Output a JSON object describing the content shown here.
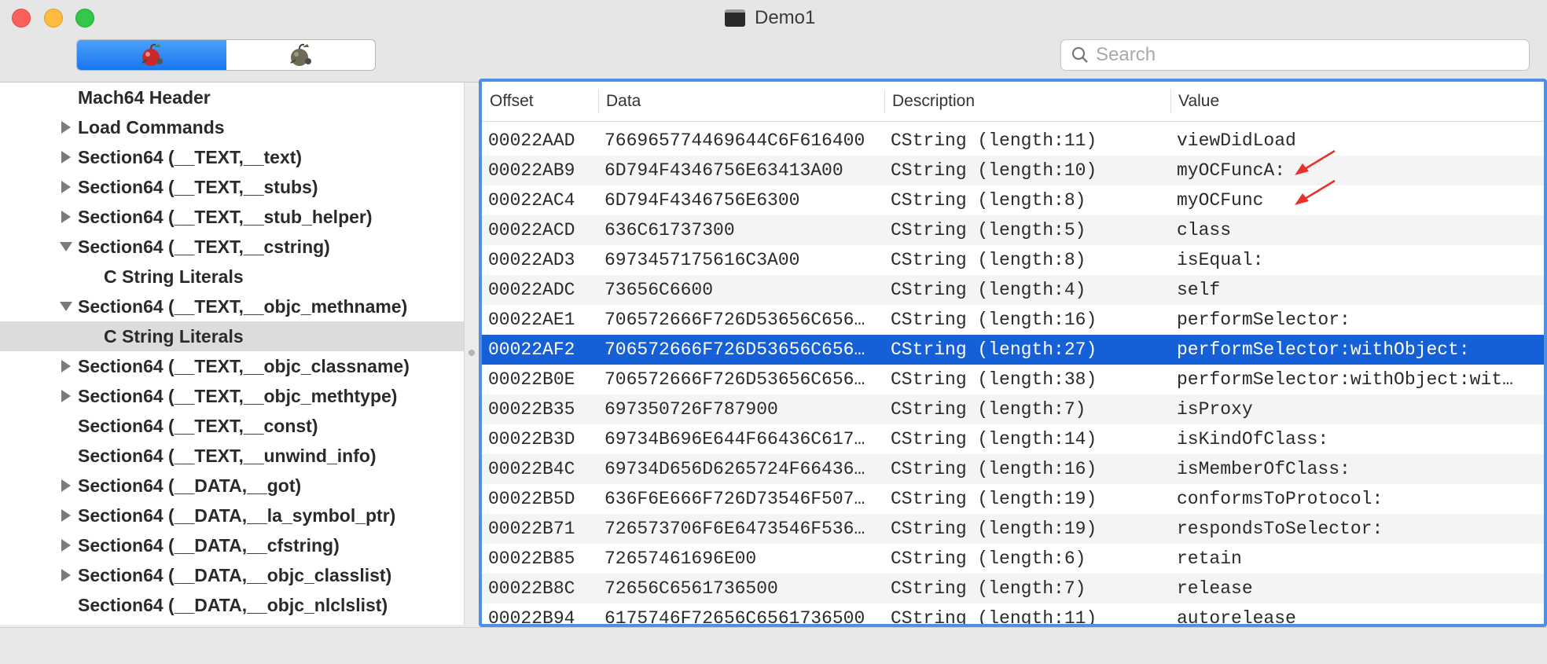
{
  "window": {
    "title": "Demo1"
  },
  "toolbar": {
    "segments": [
      {
        "icon": "apple-bomb-red-icon"
      },
      {
        "icon": "apple-bomb-gray-icon"
      }
    ],
    "search": {
      "placeholder": "Search",
      "value": ""
    }
  },
  "tree": [
    {
      "label": "Mach64 Header",
      "level": 0,
      "disclosure": "none"
    },
    {
      "label": "Load Commands",
      "level": 0,
      "disclosure": "collapsed"
    },
    {
      "label": "Section64 (__TEXT,__text)",
      "level": 0,
      "disclosure": "collapsed"
    },
    {
      "label": "Section64 (__TEXT,__stubs)",
      "level": 0,
      "disclosure": "collapsed"
    },
    {
      "label": "Section64 (__TEXT,__stub_helper)",
      "level": 0,
      "disclosure": "collapsed"
    },
    {
      "label": "Section64 (__TEXT,__cstring)",
      "level": 0,
      "disclosure": "expanded"
    },
    {
      "label": "C String Literals",
      "level": 1,
      "disclosure": "none"
    },
    {
      "label": "Section64 (__TEXT,__objc_methname)",
      "level": 0,
      "disclosure": "expanded"
    },
    {
      "label": "C String Literals",
      "level": 1,
      "disclosure": "none",
      "selected": true
    },
    {
      "label": "Section64 (__TEXT,__objc_classname)",
      "level": 0,
      "disclosure": "collapsed"
    },
    {
      "label": "Section64 (__TEXT,__objc_methtype)",
      "level": 0,
      "disclosure": "collapsed"
    },
    {
      "label": "Section64 (__TEXT,__const)",
      "level": 0,
      "disclosure": "none"
    },
    {
      "label": "Section64 (__TEXT,__unwind_info)",
      "level": 0,
      "disclosure": "none"
    },
    {
      "label": "Section64 (__DATA,__got)",
      "level": 0,
      "disclosure": "collapsed"
    },
    {
      "label": "Section64 (__DATA,__la_symbol_ptr)",
      "level": 0,
      "disclosure": "collapsed"
    },
    {
      "label": "Section64 (__DATA,__cfstring)",
      "level": 0,
      "disclosure": "collapsed"
    },
    {
      "label": "Section64 (__DATA,__objc_classlist)",
      "level": 0,
      "disclosure": "collapsed"
    },
    {
      "label": "Section64 (__DATA,__objc_nlclslist)",
      "level": 0,
      "disclosure": "none"
    }
  ],
  "table": {
    "columns": [
      "Offset",
      "Data",
      "Description",
      "Value"
    ],
    "rows": [
      {
        "offset": "00022AAD",
        "data": "766965774469644C6F616400",
        "description": "CString (length:11)",
        "value": "viewDidLoad"
      },
      {
        "offset": "00022AB9",
        "data": "6D794F4346756E63413A00",
        "description": "CString (length:10)",
        "value": "myOCFuncA:",
        "annotated": true
      },
      {
        "offset": "00022AC4",
        "data": "6D794F4346756E6300",
        "description": "CString (length:8)",
        "value": "myOCFunc",
        "annotated": true
      },
      {
        "offset": "00022ACD",
        "data": "636C61737300",
        "description": "CString (length:5)",
        "value": "class"
      },
      {
        "offset": "00022AD3",
        "data": "6973457175616C3A00",
        "description": "CString (length:8)",
        "value": "isEqual:"
      },
      {
        "offset": "00022ADC",
        "data": "73656C6600",
        "description": "CString (length:4)",
        "value": "self"
      },
      {
        "offset": "00022AE1",
        "data": "706572666F726D53656C656…",
        "description": "CString (length:16)",
        "value": "performSelector:"
      },
      {
        "offset": "00022AF2",
        "data": "706572666F726D53656C656…",
        "description": "CString (length:27)",
        "value": "performSelector:withObject:",
        "selected": true
      },
      {
        "offset": "00022B0E",
        "data": "706572666F726D53656C656…",
        "description": "CString (length:38)",
        "value": "performSelector:withObject:wit…"
      },
      {
        "offset": "00022B35",
        "data": "697350726F787900",
        "description": "CString (length:7)",
        "value": "isProxy"
      },
      {
        "offset": "00022B3D",
        "data": "69734B696E644F66436C617…",
        "description": "CString (length:14)",
        "value": "isKindOfClass:"
      },
      {
        "offset": "00022B4C",
        "data": "69734D656D6265724F66436…",
        "description": "CString (length:16)",
        "value": "isMemberOfClass:"
      },
      {
        "offset": "00022B5D",
        "data": "636F6E666F726D73546F507…",
        "description": "CString (length:19)",
        "value": "conformsToProtocol:"
      },
      {
        "offset": "00022B71",
        "data": "726573706F6E6473546F536…",
        "description": "CString (length:19)",
        "value": "respondsToSelector:"
      },
      {
        "offset": "00022B85",
        "data": "72657461696E00",
        "description": "CString (length:6)",
        "value": "retain"
      },
      {
        "offset": "00022B8C",
        "data": "72656C6561736500",
        "description": "CString (length:7)",
        "value": "release"
      },
      {
        "offset": "00022B94",
        "data": "6175746F72656C6561736500",
        "description": "CString (length:11)",
        "value": "autorelease"
      }
    ]
  },
  "colors": {
    "selection": "#1560d6",
    "annotation_arrow": "#e8312a",
    "segment_active": "#1877ee"
  }
}
